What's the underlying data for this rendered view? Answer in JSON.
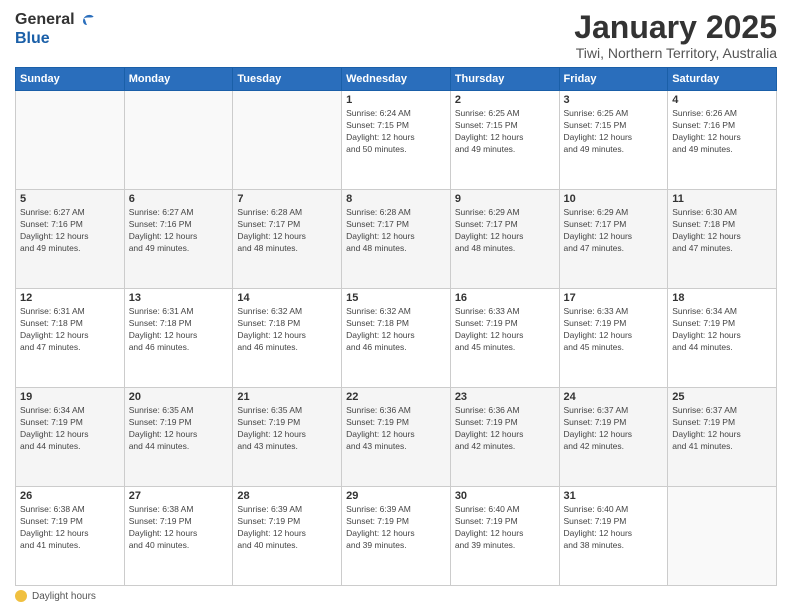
{
  "logo": {
    "general": "General",
    "blue": "Blue"
  },
  "header": {
    "month": "January 2025",
    "location": "Tiwi, Northern Territory, Australia"
  },
  "weekdays": [
    "Sunday",
    "Monday",
    "Tuesday",
    "Wednesday",
    "Thursday",
    "Friday",
    "Saturday"
  ],
  "weeks": [
    [
      {
        "day": "",
        "info": ""
      },
      {
        "day": "",
        "info": ""
      },
      {
        "day": "",
        "info": ""
      },
      {
        "day": "1",
        "info": "Sunrise: 6:24 AM\nSunset: 7:15 PM\nDaylight: 12 hours\nand 50 minutes."
      },
      {
        "day": "2",
        "info": "Sunrise: 6:25 AM\nSunset: 7:15 PM\nDaylight: 12 hours\nand 49 minutes."
      },
      {
        "day": "3",
        "info": "Sunrise: 6:25 AM\nSunset: 7:15 PM\nDaylight: 12 hours\nand 49 minutes."
      },
      {
        "day": "4",
        "info": "Sunrise: 6:26 AM\nSunset: 7:16 PM\nDaylight: 12 hours\nand 49 minutes."
      }
    ],
    [
      {
        "day": "5",
        "info": "Sunrise: 6:27 AM\nSunset: 7:16 PM\nDaylight: 12 hours\nand 49 minutes."
      },
      {
        "day": "6",
        "info": "Sunrise: 6:27 AM\nSunset: 7:16 PM\nDaylight: 12 hours\nand 49 minutes."
      },
      {
        "day": "7",
        "info": "Sunrise: 6:28 AM\nSunset: 7:17 PM\nDaylight: 12 hours\nand 48 minutes."
      },
      {
        "day": "8",
        "info": "Sunrise: 6:28 AM\nSunset: 7:17 PM\nDaylight: 12 hours\nand 48 minutes."
      },
      {
        "day": "9",
        "info": "Sunrise: 6:29 AM\nSunset: 7:17 PM\nDaylight: 12 hours\nand 48 minutes."
      },
      {
        "day": "10",
        "info": "Sunrise: 6:29 AM\nSunset: 7:17 PM\nDaylight: 12 hours\nand 47 minutes."
      },
      {
        "day": "11",
        "info": "Sunrise: 6:30 AM\nSunset: 7:18 PM\nDaylight: 12 hours\nand 47 minutes."
      }
    ],
    [
      {
        "day": "12",
        "info": "Sunrise: 6:31 AM\nSunset: 7:18 PM\nDaylight: 12 hours\nand 47 minutes."
      },
      {
        "day": "13",
        "info": "Sunrise: 6:31 AM\nSunset: 7:18 PM\nDaylight: 12 hours\nand 46 minutes."
      },
      {
        "day": "14",
        "info": "Sunrise: 6:32 AM\nSunset: 7:18 PM\nDaylight: 12 hours\nand 46 minutes."
      },
      {
        "day": "15",
        "info": "Sunrise: 6:32 AM\nSunset: 7:18 PM\nDaylight: 12 hours\nand 46 minutes."
      },
      {
        "day": "16",
        "info": "Sunrise: 6:33 AM\nSunset: 7:19 PM\nDaylight: 12 hours\nand 45 minutes."
      },
      {
        "day": "17",
        "info": "Sunrise: 6:33 AM\nSunset: 7:19 PM\nDaylight: 12 hours\nand 45 minutes."
      },
      {
        "day": "18",
        "info": "Sunrise: 6:34 AM\nSunset: 7:19 PM\nDaylight: 12 hours\nand 44 minutes."
      }
    ],
    [
      {
        "day": "19",
        "info": "Sunrise: 6:34 AM\nSunset: 7:19 PM\nDaylight: 12 hours\nand 44 minutes."
      },
      {
        "day": "20",
        "info": "Sunrise: 6:35 AM\nSunset: 7:19 PM\nDaylight: 12 hours\nand 44 minutes."
      },
      {
        "day": "21",
        "info": "Sunrise: 6:35 AM\nSunset: 7:19 PM\nDaylight: 12 hours\nand 43 minutes."
      },
      {
        "day": "22",
        "info": "Sunrise: 6:36 AM\nSunset: 7:19 PM\nDaylight: 12 hours\nand 43 minutes."
      },
      {
        "day": "23",
        "info": "Sunrise: 6:36 AM\nSunset: 7:19 PM\nDaylight: 12 hours\nand 42 minutes."
      },
      {
        "day": "24",
        "info": "Sunrise: 6:37 AM\nSunset: 7:19 PM\nDaylight: 12 hours\nand 42 minutes."
      },
      {
        "day": "25",
        "info": "Sunrise: 6:37 AM\nSunset: 7:19 PM\nDaylight: 12 hours\nand 41 minutes."
      }
    ],
    [
      {
        "day": "26",
        "info": "Sunrise: 6:38 AM\nSunset: 7:19 PM\nDaylight: 12 hours\nand 41 minutes."
      },
      {
        "day": "27",
        "info": "Sunrise: 6:38 AM\nSunset: 7:19 PM\nDaylight: 12 hours\nand 40 minutes."
      },
      {
        "day": "28",
        "info": "Sunrise: 6:39 AM\nSunset: 7:19 PM\nDaylight: 12 hours\nand 40 minutes."
      },
      {
        "day": "29",
        "info": "Sunrise: 6:39 AM\nSunset: 7:19 PM\nDaylight: 12 hours\nand 39 minutes."
      },
      {
        "day": "30",
        "info": "Sunrise: 6:40 AM\nSunset: 7:19 PM\nDaylight: 12 hours\nand 39 minutes."
      },
      {
        "day": "31",
        "info": "Sunrise: 6:40 AM\nSunset: 7:19 PM\nDaylight: 12 hours\nand 38 minutes."
      },
      {
        "day": "",
        "info": ""
      }
    ]
  ],
  "footer": {
    "label": "Daylight hours"
  }
}
